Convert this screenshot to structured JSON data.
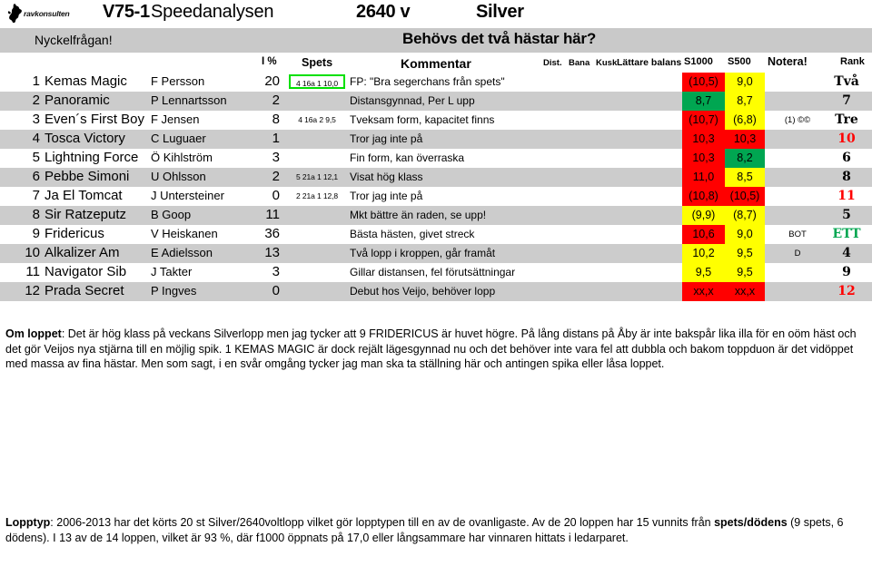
{
  "header": {
    "logo_text": "ravkonsulten",
    "logo_icon": "horse-silhouette-icon",
    "race": "V75-1",
    "product": "Speedanalysen",
    "distance": "2640 v",
    "class": "Silver"
  },
  "keyquestion": {
    "label": "Nyckelfrågan!",
    "question": "Behövs det två hästar här?"
  },
  "columns": {
    "pct": "I %",
    "spets": "Spets",
    "kommentar": "Kommentar",
    "dist": "Dist.",
    "bana": "Bana",
    "kusk": "Kusk",
    "lattare_balans": "Lättare balans",
    "s1000": "S1000",
    "s500": "S500",
    "notera": "Notera!",
    "rank": "Rank"
  },
  "rows": [
    {
      "num": "1",
      "horse": "Kemas Magic",
      "driver": "F Persson",
      "pct": "20",
      "spets": "4 16a 1 10,0",
      "spets_boxed": true,
      "kommentar": "FP: \"Bra segerchans från spets\"",
      "s1000": "(10,5)",
      "s1000_color": "red",
      "s500": "9,0",
      "s500_color": "yellow",
      "notera": "",
      "rank": "Två",
      "rank_color": "black"
    },
    {
      "num": "2",
      "horse": "Panoramic",
      "driver": "P Lennartsson",
      "pct": "2",
      "spets": "",
      "spets_boxed": false,
      "kommentar": "Distansgynnad, Per L upp",
      "s1000": "8,7",
      "s1000_color": "green",
      "s500": "8,7",
      "s500_color": "yellow",
      "notera": "",
      "rank": "7",
      "rank_color": "black"
    },
    {
      "num": "3",
      "horse": "Even´s First Boy",
      "driver": "F Jensen",
      "pct": "8",
      "spets": "4 16a 2  9,5",
      "spets_boxed": false,
      "kommentar": "Tveksam form, kapacitet finns",
      "s1000": "(10,7)",
      "s1000_color": "red",
      "s500": "(6,8)",
      "s500_color": "yellow",
      "notera": "(1) ©©",
      "rank": "Tre",
      "rank_color": "black"
    },
    {
      "num": "4",
      "horse": "Tosca Victory",
      "driver": "C Luguaer",
      "pct": "1",
      "spets": "",
      "spets_boxed": false,
      "kommentar": "Tror jag inte på",
      "s1000": "10,3",
      "s1000_color": "red",
      "s500": "10,3",
      "s500_color": "red",
      "notera": "",
      "rank": "10",
      "rank_color": "red"
    },
    {
      "num": "5",
      "horse": "Lightning Force",
      "driver": "Ö Kihlström",
      "pct": "3",
      "spets": "",
      "spets_boxed": false,
      "kommentar": "Fin form, kan överraska",
      "s1000": "10,3",
      "s1000_color": "red",
      "s500": "8,2",
      "s500_color": "green",
      "notera": "",
      "rank": "6",
      "rank_color": "black"
    },
    {
      "num": "6",
      "horse": "Pebbe Simoni",
      "driver": "U Ohlsson",
      "pct": "2",
      "spets": "5 21a 1 12,1",
      "spets_boxed": false,
      "kommentar": "Visat hög klass",
      "s1000": "11,0",
      "s1000_color": "red",
      "s500": "8,5",
      "s500_color": "yellow",
      "notera": "",
      "rank": "8",
      "rank_color": "black"
    },
    {
      "num": "7",
      "horse": "Ja El Tomcat",
      "driver": "J Untersteiner",
      "pct": "0",
      "spets": "2 21a 1 12,8",
      "spets_boxed": false,
      "kommentar": "Tror jag inte på",
      "s1000": "(10,8)",
      "s1000_color": "red",
      "s500": "(10,5)",
      "s500_color": "red",
      "notera": "",
      "rank": "11",
      "rank_color": "red"
    },
    {
      "num": "8",
      "horse": "Sir Ratzeputz",
      "driver": "B Goop",
      "pct": "11",
      "spets": "",
      "spets_boxed": false,
      "kommentar": "Mkt bättre än raden, se upp!",
      "s1000": "(9,9)",
      "s1000_color": "yellow",
      "s500": "(8,7)",
      "s500_color": "yellow",
      "notera": "",
      "rank": "5",
      "rank_color": "black"
    },
    {
      "num": "9",
      "horse": "Fridericus",
      "driver": "V Heiskanen",
      "pct": "36",
      "spets": "",
      "spets_boxed": false,
      "kommentar": "Bästa hästen, givet streck",
      "s1000": "10,6",
      "s1000_color": "red",
      "s500": "9,0",
      "s500_color": "yellow",
      "notera": "BOT",
      "rank": "ETT",
      "rank_color": "green"
    },
    {
      "num": "10",
      "horse": "Alkalizer Am",
      "driver": "E Adielsson",
      "pct": "13",
      "spets": "",
      "spets_boxed": false,
      "kommentar": "Två lopp i kroppen, går framåt",
      "s1000": "10,2",
      "s1000_color": "yellow",
      "s500": "9,5",
      "s500_color": "yellow",
      "notera": "D",
      "rank": "4",
      "rank_color": "black"
    },
    {
      "num": "11",
      "horse": "Navigator Sib",
      "driver": "J Takter",
      "pct": "3",
      "spets": "",
      "spets_boxed": false,
      "kommentar": "Gillar distansen, fel förutsättningar",
      "s1000": "9,5",
      "s1000_color": "yellow",
      "s500": "9,5",
      "s500_color": "yellow",
      "notera": "",
      "rank": "9",
      "rank_color": "black"
    },
    {
      "num": "12",
      "horse": "Prada Secret",
      "driver": "P Ingves",
      "pct": "0",
      "spets": "",
      "spets_boxed": false,
      "kommentar": "Debut hos Veijo, behöver lopp",
      "s1000": "xx,x",
      "s1000_color": "red",
      "s500": "xx,x",
      "s500_color": "red",
      "notera": "",
      "rank": "12",
      "rank_color": "red"
    }
  ],
  "about_loppet": {
    "label": "Om loppet",
    "text": ": Det är hög klass på veckans Silverlopp men jag tycker att 9 FRIDERICUS är huvet högre. På lång distans på Åby är inte bakspår lika illa för en oöm häst och det gör Veijos nya stjärna till en möjlig spik. 1 KEMAS MAGIC är dock rejält lägesgynnad nu och det behöver inte vara fel att dubbla och bakom toppduon är det vidöppet med massa av fina hästar. Men som sagt, i en svår omgång tycker jag man ska ta ställning här och antingen spika eller låsa loppet."
  },
  "about_type": {
    "label": "Lopptyp",
    "text_1": ": 2006-2013 har det körts 20 st Silver/2640voltlopp vilket gör lopptypen till en av de ovanligaste. Av de 20 loppen har 15 vunnits från ",
    "highlight": "spets/dödens",
    "text_2": " (9 spets, 6 dödens). I 13 av de 14 loppen, vilket är 93 %, där f1000 öppnats på 17,0 eller långsammare har vinnaren hittats i ledarparet."
  },
  "colors": {
    "red": "#FF0000",
    "yellow": "#FFFF00",
    "green": "#00A651",
    "rowalt": "#CCCCCC",
    "keybar": "#C9C9C9",
    "spets_box": "#00E000"
  }
}
